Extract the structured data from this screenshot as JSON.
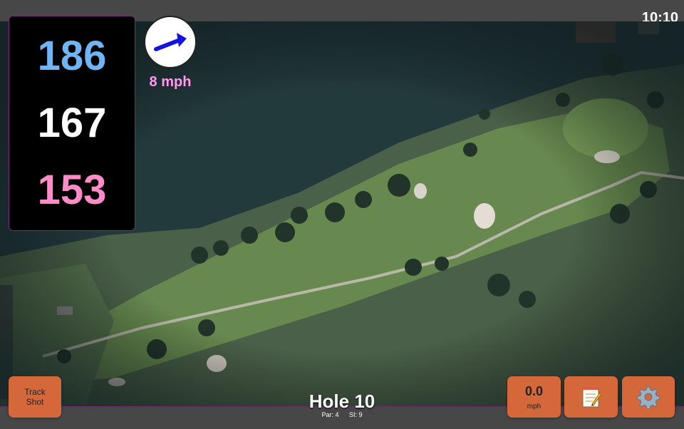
{
  "status_bar": {
    "time": "10:10"
  },
  "distances": {
    "back": "186",
    "middle": "167",
    "front": "153"
  },
  "wind": {
    "speed": "8 mph",
    "direction_icon": "wind-arrow"
  },
  "hole": {
    "title": "Hole 10",
    "par": "Par: 4",
    "stroke_index": "SI: 9"
  },
  "buttons": {
    "track_shot_line1": "Track",
    "track_shot_line2": "Shot",
    "speed_value": "0.0",
    "speed_unit": "mph",
    "notes_icon": "notepad-icon",
    "settings_icon": "gear-icon"
  },
  "colors": {
    "back_distance": "#6fb4f4",
    "middle_distance": "#ffffff",
    "front_distance": "#ff8cc8",
    "wind_speed": "#ff99ee",
    "button": "#d4683a",
    "accent_border": "#6a2a66"
  }
}
